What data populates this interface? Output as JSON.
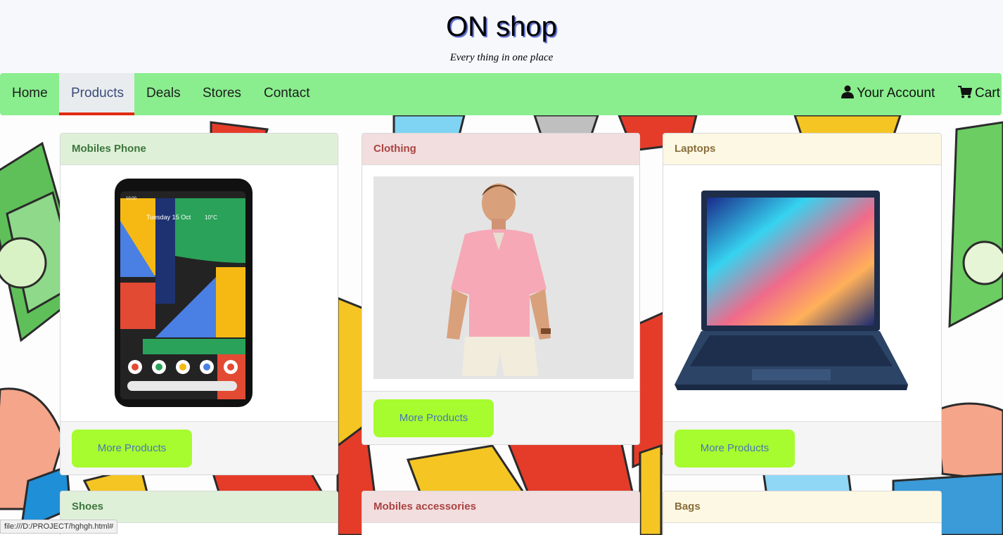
{
  "header": {
    "title": "ON shop",
    "tagline": "Every thing in one place"
  },
  "nav": {
    "items": [
      {
        "label": "Home"
      },
      {
        "label": "Products"
      },
      {
        "label": "Deals"
      },
      {
        "label": "Stores"
      },
      {
        "label": "Contact"
      }
    ],
    "active": "Products",
    "account_label": "Your Account",
    "cart_label": "Cart"
  },
  "cards": [
    {
      "title": "Mobiles Phone",
      "button": "More Products",
      "image": "smartphone-image"
    },
    {
      "title": "Clothing",
      "button": "More Products",
      "image": "man-pink-shirt-image"
    },
    {
      "title": "Laptops",
      "button": "More Products",
      "image": "laptop-image"
    },
    {
      "title": "Shoes"
    },
    {
      "title": "Mobiles accessories"
    },
    {
      "title": "Bags"
    }
  ],
  "phone_screen": {
    "time": "10:00",
    "date_text": "Tuesday 15 Oct",
    "weather": "10°C"
  },
  "status_bar": {
    "url": "file:///D:/PROJECT/hghgh.html#"
  },
  "colors": {
    "navbar": "#8aee8e",
    "active_underline": "#e02a10",
    "button": "#a6fc2e",
    "button_text": "#4a76b8"
  }
}
